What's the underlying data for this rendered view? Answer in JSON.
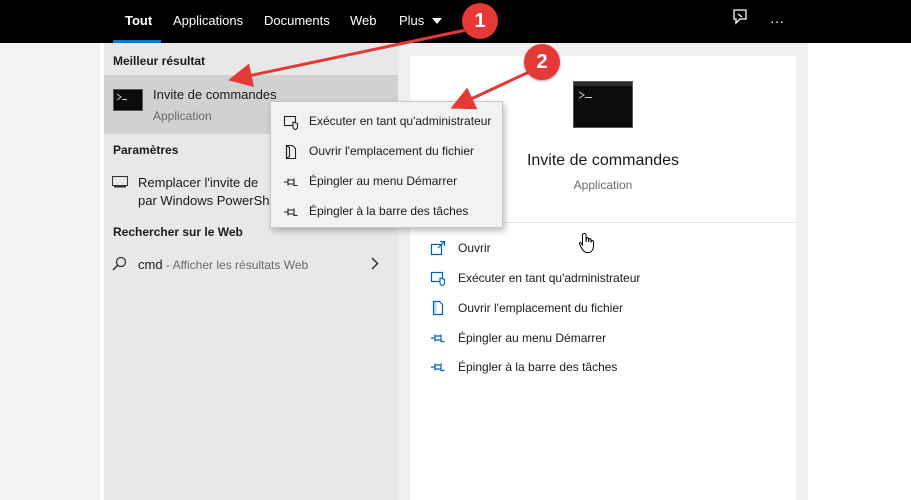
{
  "top_nav": {
    "tabs": [
      {
        "label": "Tout",
        "active": true
      },
      {
        "label": "Applications"
      },
      {
        "label": "Documents"
      },
      {
        "label": "Web"
      },
      {
        "label": "Plus"
      }
    ],
    "plus_dropdown_icon": "chevron-down-icon",
    "feedback_icon": "feedback-icon",
    "more_icon": "more-icon",
    "more_glyph": "···"
  },
  "left": {
    "best_match_title": "Meilleur résultat",
    "best_match": {
      "name": "Invite de commandes",
      "type": "Application"
    },
    "settings_title": "Paramètres",
    "settings_item": {
      "line1": "Remplacer l'invite de",
      "line2": "par Windows PowerSh"
    },
    "web_title": "Rechercher sur le Web",
    "web_item": {
      "query": "cmd",
      "suffix": " - Afficher les résultats Web"
    }
  },
  "context_menu": {
    "items": [
      {
        "label": "Exécuter en tant qu'administrateur",
        "icon": "run-as-admin-icon"
      },
      {
        "label": "Ouvrir l'emplacement du fichier",
        "icon": "file-location-icon"
      },
      {
        "label": "Épingler au menu Démarrer",
        "icon": "pin-icon"
      },
      {
        "label": "Épingler à la barre des tâches",
        "icon": "pin-icon"
      }
    ]
  },
  "preview": {
    "name": "Invite de commandes",
    "type": "Application",
    "actions": [
      {
        "label": "Ouvrir",
        "icon": "open-icon"
      },
      {
        "label": "Exécuter en tant qu'administrateur",
        "icon": "run-as-admin-icon"
      },
      {
        "label": "Ouvrir l'emplacement du fichier",
        "icon": "file-location-icon"
      },
      {
        "label": "Épingler au menu Démarrer",
        "icon": "pin-icon"
      },
      {
        "label": "Épingler à la barre des tâches",
        "icon": "pin-icon"
      }
    ]
  },
  "annotations": {
    "badge1": "1",
    "badge2": "2",
    "color": "#e53935"
  },
  "colors": {
    "accent": "#0078d7",
    "icon_blue": "#0063b1"
  }
}
